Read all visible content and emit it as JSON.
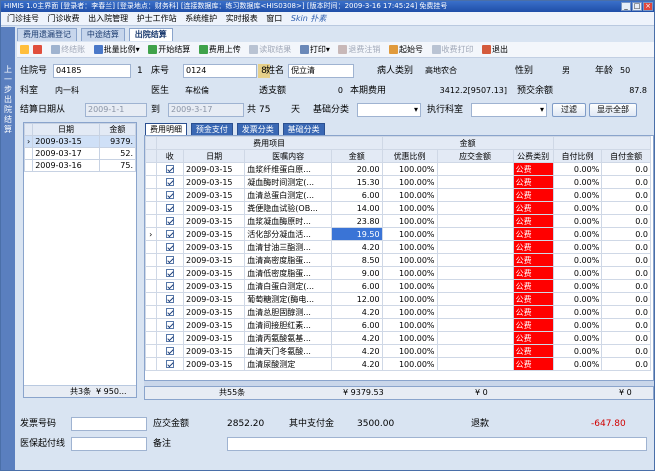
{
  "window": {
    "title": "HIMIS 1.0主界面  [登录者：李春兰]  [登录地点：财务科]  [连接数据库：练习数据库<HIS0308>]  [版本时间：2009-3-16 17:45:24]  免费挂号",
    "minimize": "_",
    "maximize": "□",
    "close": "×"
  },
  "menu": [
    "门诊挂号",
    "门诊收费",
    "出入院管理",
    "护士工作站",
    "系统维护",
    "实时报表",
    "窗口"
  ],
  "menu_skin": "Skin 扑素",
  "side_label": "上一步\n出院结算",
  "tabs": [
    "费用遗漏登记",
    "中途结算",
    "出院结算"
  ],
  "toolbar": {
    "items": [
      {
        "label": "终结账",
        "enabled": false
      },
      {
        "label": "批量比例",
        "enabled": true
      },
      {
        "label": "开始结算",
        "enabled": true
      },
      {
        "label": "费用上传",
        "enabled": true
      },
      {
        "label": "读取结果",
        "enabled": false
      },
      {
        "label": "打印",
        "enabled": true
      },
      {
        "label": "退费注销",
        "enabled": false
      },
      {
        "label": "起始号",
        "enabled": true
      },
      {
        "label": "收费打印",
        "enabled": false
      },
      {
        "label": "退出",
        "enabled": true
      }
    ],
    "colors": {
      "accent": "#2f5fb0",
      "disabled": "#a0a8b8"
    }
  },
  "form": {
    "admission_no_label": "住院号",
    "admission_no": "04185",
    "num1": "1",
    "bed_label": "床号",
    "bed": "0124",
    "name_chip": "8",
    "name_label": "姓名",
    "name": "倪立清",
    "patient_type_label": "病人类别",
    "patient_type": "高地农合",
    "sex_label": "性别",
    "sex": "男",
    "age_label": "年龄",
    "age": "50",
    "dept_label": "科室",
    "dept": "内一科",
    "doctor_label": "医生",
    "doctor": "车松倫",
    "overdue_label": "透支额",
    "overdue": "0",
    "cur_fee_label": "本期费用",
    "cur_fee": "3412.2[9507.13]",
    "deposit_label": "预交余额",
    "deposit": "87.8",
    "settle_date_label": "结算日期从",
    "date_from": "2009-1-1",
    "to_label": "到",
    "date_to": "2009-3-17",
    "days_label": "共",
    "days": "75",
    "days_unit": "天",
    "base_class_label": "基础分类",
    "exec_dept_label": "执行科室",
    "filter_button": "过滤",
    "show_all_button": "显示全部"
  },
  "left_grid": {
    "headers": [
      "日期",
      "金额"
    ],
    "rows": [
      {
        "date": "2009-03-15",
        "amount": "9379."
      },
      {
        "date": "2009-03-17",
        "amount": "52."
      },
      {
        "date": "2009-03-16",
        "amount": "75."
      }
    ],
    "footer_count": "共3条",
    "footer_amount": "¥ 950..."
  },
  "sub_tabs": [
    "费用明细",
    "预金支付",
    "发票分类",
    "基础分类"
  ],
  "main_grid": {
    "group_headers": [
      "费用项目",
      "金额"
    ],
    "headers": [
      "收",
      "日期",
      "医嘱内容",
      "金额",
      "优惠比例",
      "应交金额",
      "公费类别",
      "自付比例",
      "自付金额"
    ],
    "rows": [
      {
        "date": "2009-03-15",
        "item": "血浆纤维蛋白原...",
        "amount": "20.00",
        "ratio": "100.00%",
        "due": "",
        "cat": "公费",
        "self_ratio": "0.00%",
        "self_amt": "0.0"
      },
      {
        "date": "2009-03-15",
        "item": "凝血酶时间测定(...",
        "amount": "15.30",
        "ratio": "100.00%",
        "due": "",
        "cat": "公费",
        "self_ratio": "0.00%",
        "self_amt": "0.0"
      },
      {
        "date": "2009-03-15",
        "item": "血清总蛋白测定(...",
        "amount": "6.00",
        "ratio": "100.00%",
        "due": "",
        "cat": "公费",
        "self_ratio": "0.00%",
        "self_amt": "0.0"
      },
      {
        "date": "2009-03-15",
        "item": "粪便隐血试验(OB...",
        "amount": "14.00",
        "ratio": "100.00%",
        "due": "",
        "cat": "公费",
        "self_ratio": "0.00%",
        "self_amt": "0.0"
      },
      {
        "date": "2009-03-15",
        "item": "血浆凝血酶原时...",
        "amount": "23.80",
        "ratio": "100.00%",
        "due": "",
        "cat": "公费",
        "self_ratio": "0.00%",
        "self_amt": "0.0"
      },
      {
        "date": "2009-03-15",
        "item": "活化部分凝血活...",
        "amount": "19.50",
        "ratio": "100.00%",
        "due": "",
        "cat": "公费",
        "self_ratio": "0.00%",
        "self_amt": "0.0"
      },
      {
        "date": "2009-03-15",
        "item": "血清甘油三酯测...",
        "amount": "4.20",
        "ratio": "100.00%",
        "due": "",
        "cat": "公费",
        "self_ratio": "0.00%",
        "self_amt": "0.0"
      },
      {
        "date": "2009-03-15",
        "item": "血清高密度脂蛋...",
        "amount": "8.50",
        "ratio": "100.00%",
        "due": "",
        "cat": "公费",
        "self_ratio": "0.00%",
        "self_amt": "0.0"
      },
      {
        "date": "2009-03-15",
        "item": "血清低密度脂蛋...",
        "amount": "9.00",
        "ratio": "100.00%",
        "due": "",
        "cat": "公费",
        "self_ratio": "0.00%",
        "self_amt": "0.0"
      },
      {
        "date": "2009-03-15",
        "item": "血清白蛋白测定(...",
        "amount": "6.00",
        "ratio": "100.00%",
        "due": "",
        "cat": "公费",
        "self_ratio": "0.00%",
        "self_amt": "0.0"
      },
      {
        "date": "2009-03-15",
        "item": "葡萄糖测定(酶电...",
        "amount": "12.00",
        "ratio": "100.00%",
        "due": "",
        "cat": "公费",
        "self_ratio": "0.00%",
        "self_amt": "0.0"
      },
      {
        "date": "2009-03-15",
        "item": "血清总胆固醇测...",
        "amount": "4.20",
        "ratio": "100.00%",
        "due": "",
        "cat": "公费",
        "self_ratio": "0.00%",
        "self_amt": "0.0"
      },
      {
        "date": "2009-03-15",
        "item": "血清间接胆红素...",
        "amount": "6.00",
        "ratio": "100.00%",
        "due": "",
        "cat": "公费",
        "self_ratio": "0.00%",
        "self_amt": "0.0"
      },
      {
        "date": "2009-03-15",
        "item": "血清丙氨酸氨基...",
        "amount": "4.20",
        "ratio": "100.00%",
        "due": "",
        "cat": "公费",
        "self_ratio": "0.00%",
        "self_amt": "0.0"
      },
      {
        "date": "2009-03-15",
        "item": "血清天门冬氨酸...",
        "amount": "4.20",
        "ratio": "100.00%",
        "due": "",
        "cat": "公费",
        "self_ratio": "0.00%",
        "self_amt": "0.0"
      },
      {
        "date": "2009-03-15",
        "item": "血清尿酸测定",
        "amount": "4.20",
        "ratio": "100.00%",
        "due": "",
        "cat": "公费",
        "self_ratio": "0.00%",
        "self_amt": "0.0"
      }
    ],
    "selected_row": 5,
    "footer_count": "共55条",
    "footer_amount": "¥ 9379.53",
    "footer_due": "¥ 0",
    "footer_self": "¥ 0",
    "pub_color": "#ff0000"
  },
  "bottom": {
    "invoice_label": "发票号码",
    "invoice": "",
    "due_label": "应交金额",
    "due": "2852.20",
    "fund_label": "其中支付金",
    "fund": "3500.00",
    "refund_label": "退款",
    "refund": "-647.80",
    "start_line_label": "医保起付线",
    "start_line": "",
    "remark_label": "备注",
    "remark": "",
    "refund_color": "#d00000"
  }
}
